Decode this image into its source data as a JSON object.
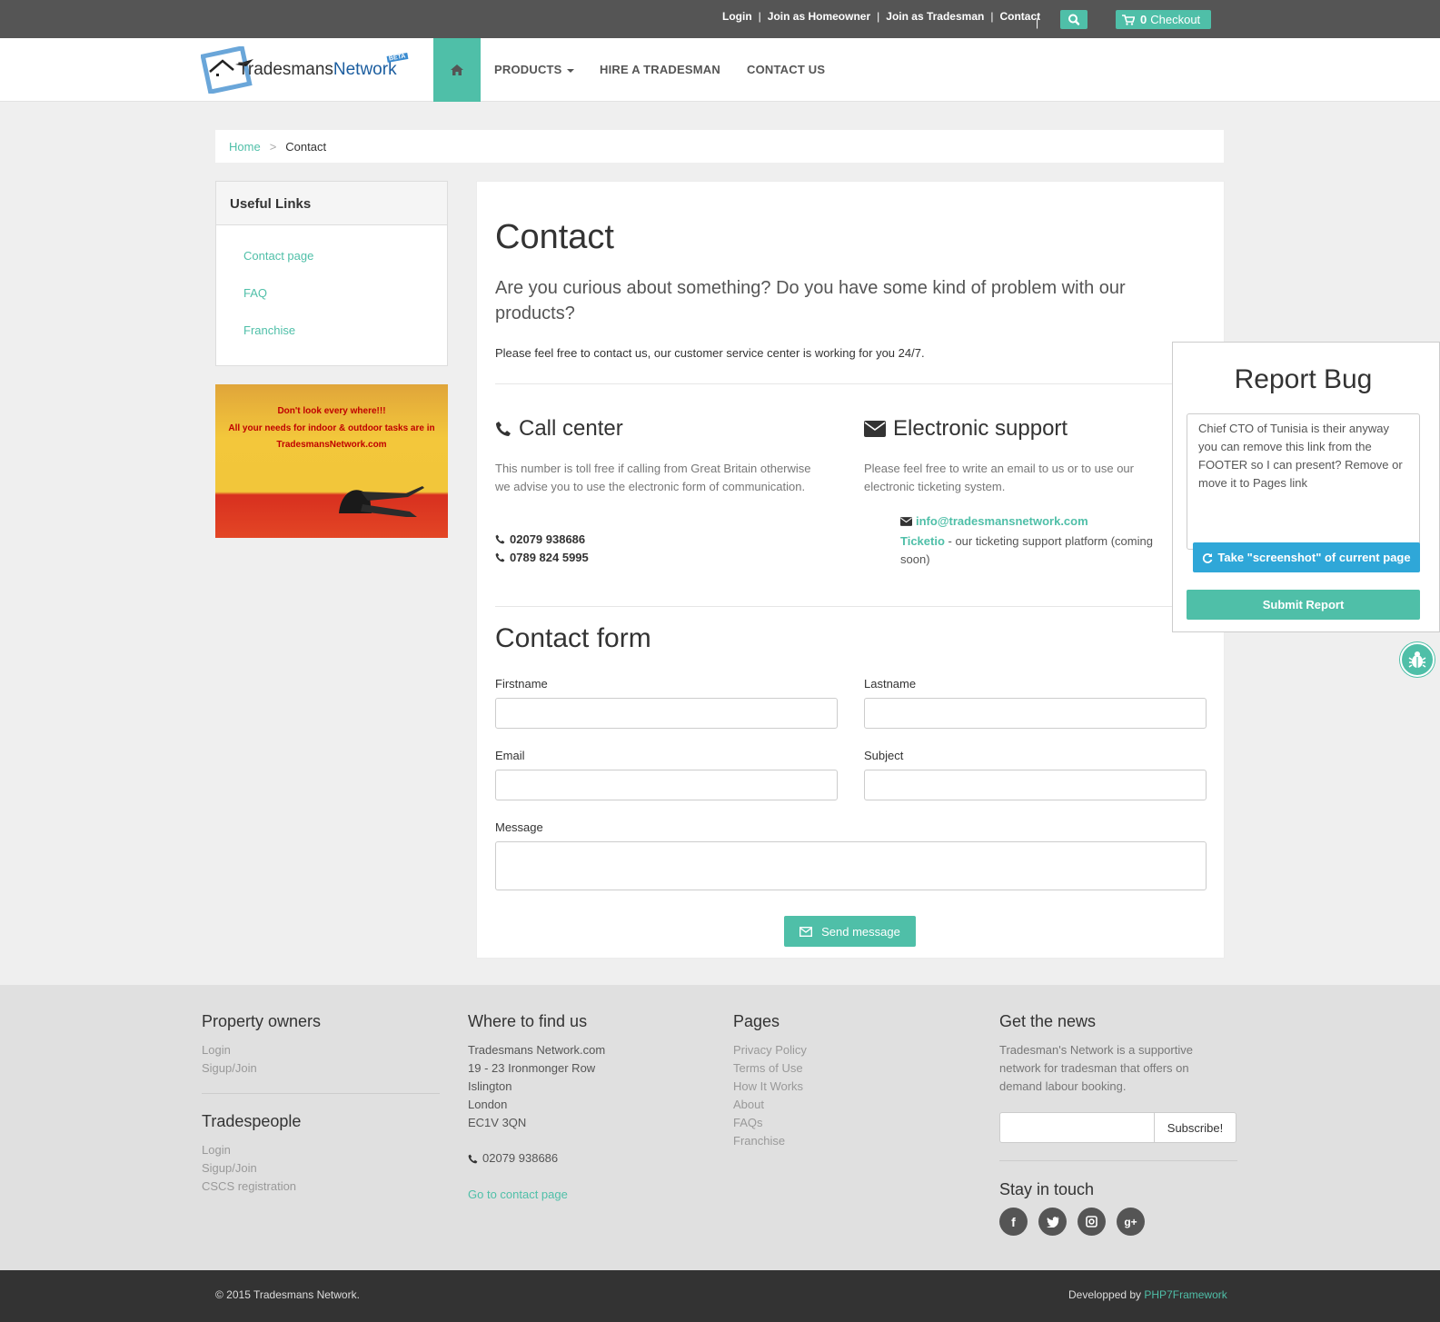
{
  "topbar": {
    "links": [
      "Login",
      "Join as Homeowner",
      "Join as Tradesman",
      "Contact"
    ],
    "cart_count": "0",
    "cart_label": "Checkout"
  },
  "logo": {
    "part1": "Tradesmans",
    "part2": "Network",
    "badge": "BETA"
  },
  "nav": {
    "products": "PRODUCTS",
    "hire": "HIRE A TRADESMAN",
    "contact": "CONTACT US"
  },
  "breadcrumb": {
    "home": "Home",
    "sep": ">",
    "current": "Contact"
  },
  "sidebar": {
    "title": "Useful Links",
    "links": [
      "Contact page",
      "FAQ",
      "Franchise"
    ],
    "ad_lines": [
      "Don't look every where!!!",
      "All your needs for indoor & outdoor tasks are in",
      "TradesmansNetwork.com"
    ]
  },
  "main": {
    "title": "Contact",
    "lead": "Are you curious about something? Do you have some kind of problem with our products?",
    "text": "Please feel free to contact us, our customer service center is working for you 24/7.",
    "call": {
      "title": "Call center",
      "text": "This number is toll free if calling from Great Britain otherwise we advise you to use the electronic form of communication.",
      "phone1": "02079 938686",
      "phone2": "0789 824 5995"
    },
    "support": {
      "title": "Electronic support",
      "text": "Please feel free to write an email to us or to use our electronic ticketing system.",
      "email": "info@tradesmansnetwork.com",
      "ticket_name": "Ticketio",
      "ticket_text": " - our ticketing support platform (coming soon)"
    },
    "form": {
      "title": "Contact form",
      "firstname": "Firstname",
      "lastname": "Lastname",
      "email": "Email",
      "subject": "Subject",
      "message": "Message",
      "submit": "Send message"
    }
  },
  "bug": {
    "title": "Report Bug",
    "text": "Chief CTO of Tunisia is their anyway you can remove this link from the FOOTER so I can present? Remove or move it to Pages link",
    "screenshot": "Take \"screenshot\" of current page",
    "submit": "Submit Report"
  },
  "footer": {
    "owners": {
      "title": "Property owners",
      "links": [
        "Login",
        "Sigup/Join"
      ]
    },
    "trades": {
      "title": "Tradespeople",
      "links": [
        "Login",
        "Sigup/Join",
        "CSCS registration"
      ]
    },
    "find": {
      "title": "Where to find us",
      "address": [
        "Tradesmans Network.com",
        "19 - 23 Ironmonger Row",
        "Islington",
        "London",
        "EC1V 3QN"
      ],
      "phone": "02079 938686",
      "link": "Go to contact page"
    },
    "pages": {
      "title": "Pages",
      "links": [
        "Privacy Policy",
        "Terms of Use",
        "How It Works",
        "About",
        "FAQs",
        "Franchise"
      ]
    },
    "news": {
      "title": "Get the news",
      "text": "Tradesman's Network is a supportive network for tradesman that offers on demand labour booking.",
      "subscribe": "Subscribe!"
    },
    "touch": {
      "title": "Stay in touch",
      "icons": [
        "facebook-icon",
        "twitter-icon",
        "instagram-icon",
        "google-plus-icon"
      ]
    }
  },
  "bottom": {
    "copyright": "© 2015 Tradesmans Network.",
    "dev_prefix": "Developped by ",
    "dev_link": "PHP7Framework"
  },
  "colors": {
    "accent": "#4fbfa8",
    "blue": "#2fa7d8",
    "topbar": "#555555",
    "bottombar": "#333333"
  }
}
